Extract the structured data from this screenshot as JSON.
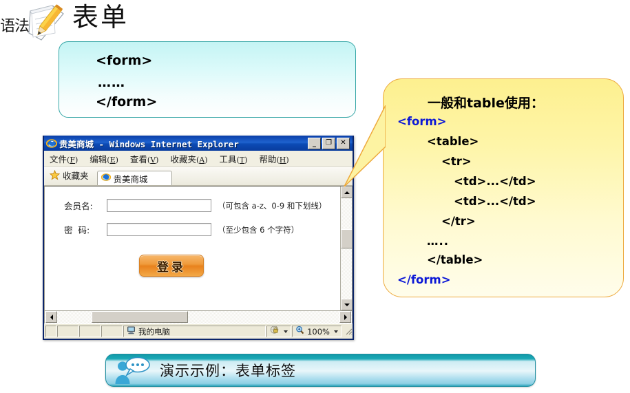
{
  "slide": {
    "heading_badge": "语法",
    "heading_title": "表单"
  },
  "code_box": {
    "line1": "<form>",
    "line2": "……",
    "line3": "</form>"
  },
  "browser": {
    "title": "贵美商城 - Windows Internet Explorer",
    "title_cn": "贵美商城",
    "title_en": " - Windows Internet Explorer",
    "window_buttons": {
      "minimize": "_",
      "maximize": "❐",
      "close": "✕"
    },
    "menu": [
      {
        "label": "文件",
        "accel": "F"
      },
      {
        "label": "编辑",
        "accel": "E"
      },
      {
        "label": "查看",
        "accel": "V"
      },
      {
        "label": "收藏夹",
        "accel": "A"
      },
      {
        "label": "工具",
        "accel": "T"
      },
      {
        "label": "帮助",
        "accel": "H"
      }
    ],
    "favorites_label": "收藏夹",
    "tab_label": "贵美商城",
    "page": {
      "fields": [
        {
          "label": "会员名:",
          "value": "",
          "hint": "（可包含 a-z、0-9 和下划线）"
        },
        {
          "label": "密  码:",
          "value": "",
          "hint": "（至少包含 6 个字符）"
        }
      ],
      "submit_label": "登录"
    },
    "status": {
      "zone_text": "我的电脑",
      "zoom_level": "100%"
    }
  },
  "callout": {
    "heading": "一般和table使用：",
    "lines": [
      {
        "text": "<form>",
        "color": "blue"
      },
      {
        "text": "<table>",
        "color": "black"
      },
      {
        "text": "<tr>",
        "color": "black"
      },
      {
        "text": "<td>...</td>",
        "color": "black"
      },
      {
        "text": "<td>...</td>",
        "color": "black"
      },
      {
        "text": "</tr>",
        "color": "black"
      },
      {
        "text": "…..",
        "color": "black"
      },
      {
        "text": "</table>",
        "color": "black"
      },
      {
        "text": "</form>",
        "color": "blue"
      }
    ]
  },
  "banner": {
    "text": "演示示例：表单标签"
  },
  "colors": {
    "code_box_border": "#35a6a6",
    "code_box_bg_top": "#c4f4f4",
    "callout_border": "#eda93c",
    "callout_bg_top": "#fdf08f",
    "callout_tag_blue": "#0b17d6",
    "banner_teal": "#139aa8",
    "login_orange": "#e8821d",
    "ie_titlebar_blue": "#0a3fa8"
  }
}
